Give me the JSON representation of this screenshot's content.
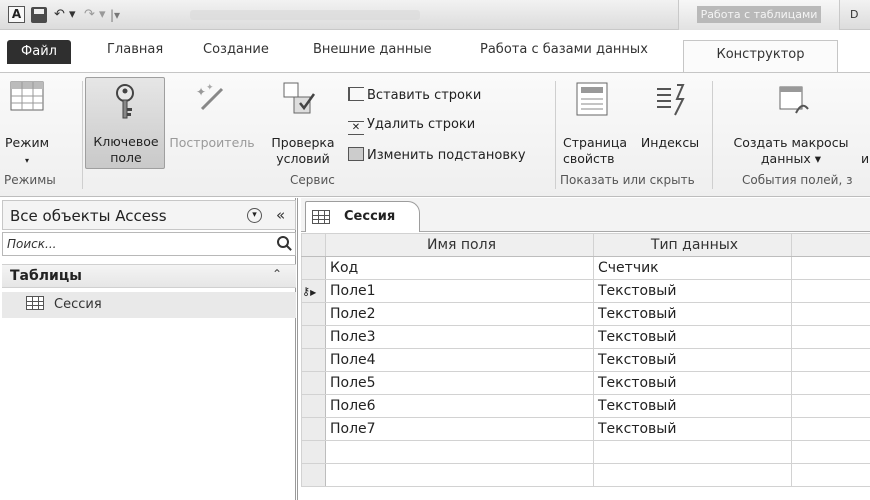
{
  "titlebar": {
    "app_icon": "A",
    "context_tab_title": "Работа с таблицами",
    "right_text": "D",
    "icons": [
      "access-app-icon",
      "save-icon",
      "undo-icon",
      "redo-icon"
    ]
  },
  "tabs": {
    "file": "Файл",
    "home": "Главная",
    "create": "Создание",
    "external": "Внешние данные",
    "database": "Работа с базами данных",
    "designer": "Конструктор"
  },
  "ribbon": {
    "views": {
      "mode_label": "Режим",
      "group_label": "Режимы"
    },
    "tools": {
      "primary_key": "Ключевое поле",
      "builder": "Построитель",
      "validation": "Проверка условий",
      "insert_rows": "Вставить строки",
      "delete_rows": "Удалить строки",
      "modify_lookups": "Изменить подстановку",
      "group_label": "Сервис"
    },
    "show_hide": {
      "property_sheet": "Страница свойств",
      "indexes": "Индексы",
      "group_label": "Показать или скрыть"
    },
    "field_events": {
      "create_macros": "Создать макросы данных ▾",
      "extra": "и",
      "group_label": "События полей, з"
    }
  },
  "nav": {
    "title": "Все объекты Access",
    "search_placeholder": "Поиск...",
    "group_title": "Таблицы",
    "items": [
      {
        "label": "Сессия"
      }
    ]
  },
  "document": {
    "tab_label": "Сессия",
    "columns": {
      "field_name": "Имя поля",
      "data_type": "Тип данных",
      "description": ""
    },
    "rows": [
      {
        "name": "Код",
        "type": "Счетчик",
        "key": false,
        "current": false
      },
      {
        "name": "Поле1",
        "type": "Текстовый",
        "key": true,
        "current": true
      },
      {
        "name": "Поле2",
        "type": "Текстовый",
        "key": false,
        "current": false
      },
      {
        "name": "Поле3",
        "type": "Текстовый",
        "key": false,
        "current": false
      },
      {
        "name": "Поле4",
        "type": "Текстовый",
        "key": false,
        "current": false
      },
      {
        "name": "Поле5",
        "type": "Текстовый",
        "key": false,
        "current": false
      },
      {
        "name": "Поле6",
        "type": "Текстовый",
        "key": false,
        "current": false
      },
      {
        "name": "Поле7",
        "type": "Текстовый",
        "key": false,
        "current": false
      }
    ]
  }
}
